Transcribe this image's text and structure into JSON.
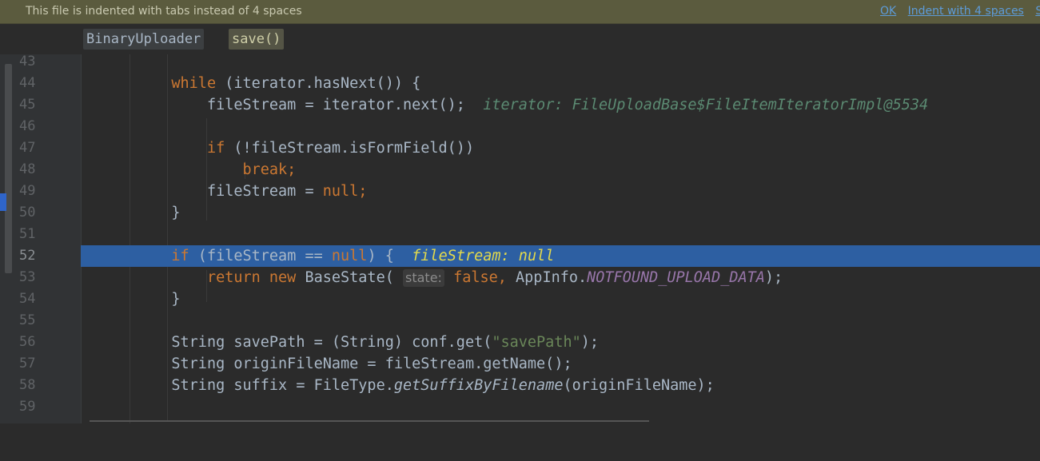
{
  "notification": {
    "message": "This file is indented with tabs instead of 4 spaces",
    "ok": "OK",
    "indent": "Indent with 4 spaces",
    "more": "S"
  },
  "breadcrumb": [
    "BinaryUploader",
    "save()"
  ],
  "colors": {
    "background": "#2b2b2b",
    "keyword": "#cc7832",
    "string": "#6a8759",
    "constant": "#9876aa",
    "highlight": "#2d5fa2",
    "debug_inline": "#5b8a72",
    "debug_current": "#e3d94c"
  },
  "lines": [
    {
      "num": "43"
    },
    {
      "num": "44",
      "kw1": "while",
      "text1": " (iterator.hasNext()) {"
    },
    {
      "num": "45",
      "text1": "fileStream = iterator.next();",
      "debug": "iterator: FileUploadBase$FileItemIteratorImpl@5534"
    },
    {
      "num": "46"
    },
    {
      "num": "47",
      "kw1": "if",
      "text1": " (!fileStream.isFormField())"
    },
    {
      "num": "48",
      "kw1": "break;"
    },
    {
      "num": "49",
      "text1": "fileStream = ",
      "kw2": "null;"
    },
    {
      "num": "50",
      "text1": "}"
    },
    {
      "num": "51"
    },
    {
      "num": "52",
      "kw1": "if",
      "text1": " (fileStream == ",
      "kw2": "null",
      "text2": ") {",
      "debug": "fileStream: null"
    },
    {
      "num": "53",
      "kw1": "return new",
      "text1": " BaseState(",
      "hint": "state:",
      "kw2": "false,",
      "text2": " AppInfo.",
      "const": "NOTFOUND_UPLOAD_DATA",
      "text3": ");"
    },
    {
      "num": "54",
      "text1": "}"
    },
    {
      "num": "55"
    },
    {
      "num": "56",
      "text1": "String savePath = (String) conf.get(",
      "str": "\"savePath\"",
      "text2": ");"
    },
    {
      "num": "57",
      "text1": "String originFileName = fileStream.getName();"
    },
    {
      "num": "58",
      "text1": "String suffix = FileType.",
      "italic": "getSuffixByFilename",
      "text2": "(originFileName);"
    },
    {
      "num": "59"
    }
  ]
}
